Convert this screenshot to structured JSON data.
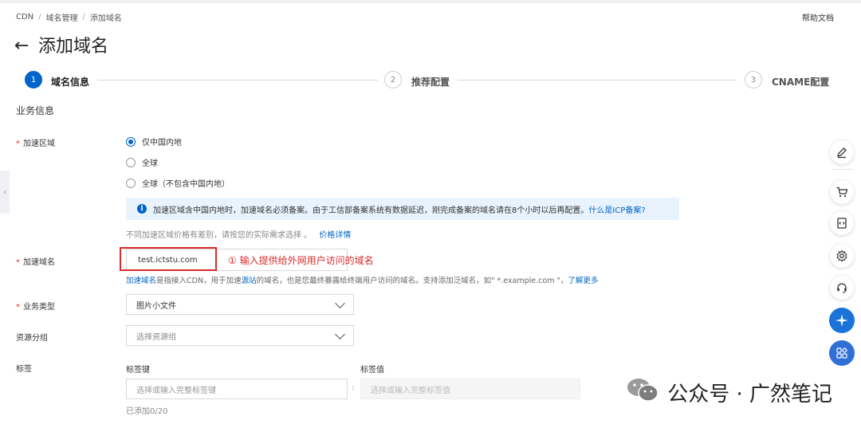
{
  "breadcrumb": {
    "items": [
      "CDN",
      "域名管理",
      "添加域名"
    ],
    "separator": "/"
  },
  "help_link": "帮助文档",
  "page_title": "添加域名",
  "steps": [
    {
      "number": "1",
      "label": "域名信息"
    },
    {
      "number": "2",
      "label": "推荐配置"
    },
    {
      "number": "3",
      "label": "CNAME配置"
    }
  ],
  "section_title": "业务信息",
  "region": {
    "label": "加速区域",
    "options": [
      "仅中国内地",
      "全球",
      "全球（不包含中国内地）"
    ],
    "selected_index": 0,
    "notice_text": "加速区域含中国内地时，加速域名必须备案。由于工信部备案系统有数据延迟，刚完成备案的域名请在8个小时以后再配置。",
    "notice_link": "什么是ICP备案?",
    "hint_text": "不同加速区域价格有差别，请按您的实际需求选择 。",
    "hint_link": "价格详情"
  },
  "domain": {
    "label": "加速域名",
    "value": "test.ictstu.com",
    "annotation": "① 输入提供给外网用户访问的域名",
    "help_link1": "加速域名",
    "help_text1": "是指接入CDN，用于加速",
    "help_link2": "源站",
    "help_text2": "的域名，也是您最终暴露给终端用户访问的域名。支持添加泛域名，如\" *.example.com \"，",
    "help_link3": "了解更多"
  },
  "business_type": {
    "label": "业务类型",
    "value": "图片小文件"
  },
  "resource_group": {
    "label": "资源分组",
    "placeholder": "选择资源组"
  },
  "tags": {
    "label": "标签",
    "key_header": "标签键",
    "value_header": "标签值",
    "key_placeholder": "选择或输入完整标签键",
    "value_placeholder": "选择或输入完整标签值",
    "colon": ":",
    "count_text": "已添加0/20"
  },
  "watermark": "公众号 · 广然笔记",
  "colors": {
    "primary": "#0064c8",
    "required": "#e62e2e",
    "annotation": "#d92b2b",
    "notice_bg": "#e9f3fd"
  },
  "floating_tools": [
    "edit-icon",
    "cart-icon",
    "code-doc-icon",
    "gear-icon",
    "headset-icon",
    "spark-icon",
    "apps-icon"
  ]
}
